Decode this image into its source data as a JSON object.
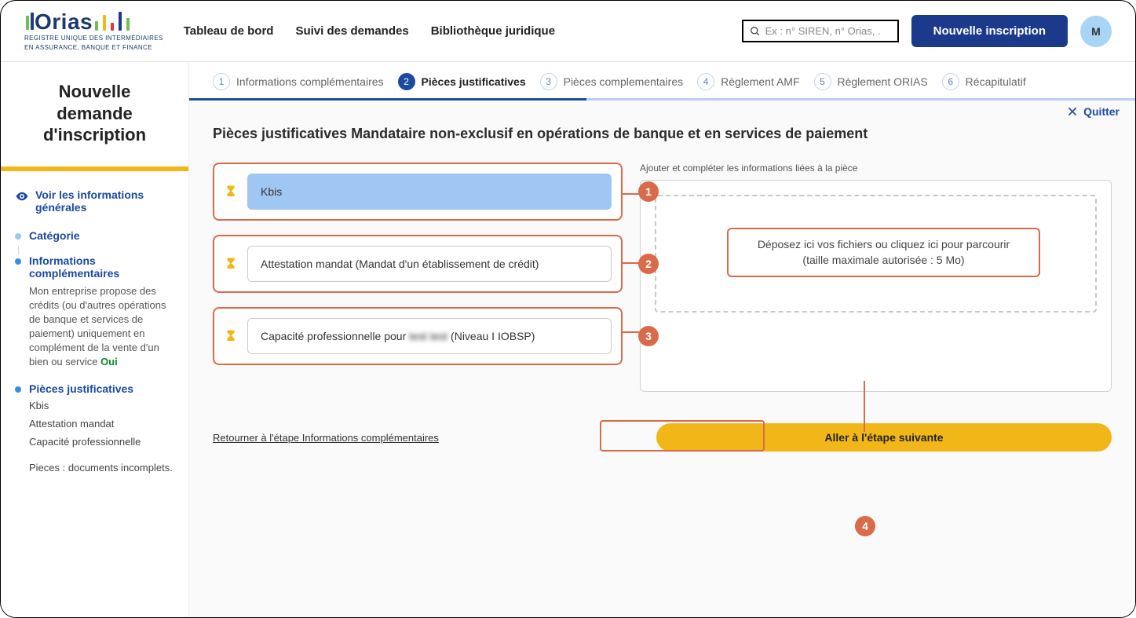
{
  "header": {
    "logo_name": "Orias",
    "logo_sub1": "REGISTRE UNIQUE DES INTERMÉDIAIRES",
    "logo_sub2": "EN ASSURANCE, BANQUE ET FINANCE",
    "nav": {
      "dashboard": "Tableau de bord",
      "tracking": "Suivi des demandes",
      "library": "Bibliothèque juridique"
    },
    "search_placeholder": "Ex : n° SIREN, n° Orias, .",
    "new_registration": "Nouvelle inscription",
    "avatar_initial": "M"
  },
  "sidebar": {
    "title_l1": "Nouvelle",
    "title_l2": "demande",
    "title_l3": "d'inscription",
    "general_info": "Voir les informations générales",
    "category": "Catégorie",
    "compl_info": "Informations complémentaires",
    "compl_desc_pre": "Mon entreprise propose des crédits (ou d'autres opérations de banque et services de paiement) uniquement en complément de la vente d'un bien ou service ",
    "compl_desc_val": "Oui",
    "pieces": "Pièces justificatives",
    "piece1": "Kbis",
    "piece2": "Attestation mandat",
    "piece3": "Capacité professionnelle",
    "pieces_status": "Pieces : documents incomplets."
  },
  "stepper": {
    "s1": "Informations complémentaires",
    "s2": "Pièces justificatives",
    "s3": "Pièces complementaires",
    "s4": "Règlement AMF",
    "s5": "Règlement ORIAS",
    "s6": "Récapitulatif"
  },
  "main": {
    "quit": "Quitter",
    "section_title": "Pièces justificatives Mandataire non-exclusif en opérations de banque et en services de paiement",
    "doc1": "Kbis",
    "doc2": "Attestation mandat (Mandat d'un établissement de crédit)",
    "doc3_pre": "Capacité professionnelle pour ",
    "doc3_blur": "test test",
    "doc3_post": " (Niveau I IOBSP)",
    "upload_label": "Ajouter et compléter les informations liées à la pièce",
    "drop_l1": "Déposez ici vos fichiers ou cliquez ici pour parcourir",
    "drop_l2": "(taille maximale autorisée : 5 Mo)",
    "back": "Retourner à l'étape Informations complémentaires",
    "next": "Aller à l'étape suivante"
  },
  "annotations": {
    "a1": "1",
    "a2": "2",
    "a3": "3",
    "a4": "4"
  }
}
